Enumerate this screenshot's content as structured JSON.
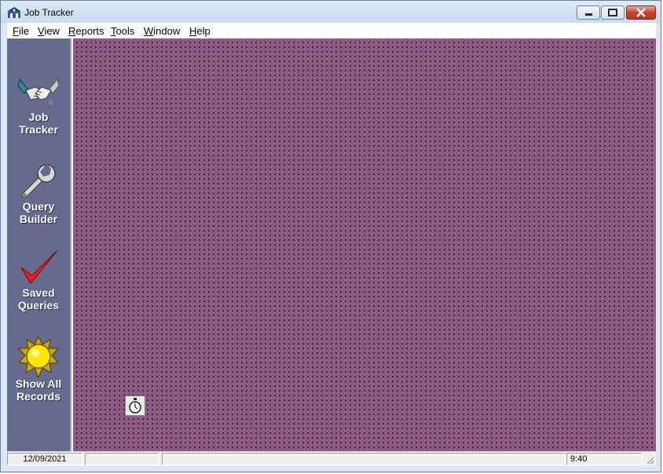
{
  "window": {
    "title": "Job Tracker"
  },
  "menu": [
    {
      "label": "File",
      "accel": "F",
      "rest": "ile"
    },
    {
      "label": "View",
      "accel": "V",
      "rest": "iew"
    },
    {
      "label": "Reports",
      "accel": "R",
      "rest": "eports"
    },
    {
      "label": "Tools",
      "accel": "T",
      "rest": "ools"
    },
    {
      "label": "Window",
      "accel": "W",
      "rest": "indow"
    },
    {
      "label": "Help",
      "accel": "H",
      "rest": "elp"
    }
  ],
  "sidebar": {
    "items": [
      {
        "label": "Job\nTracker",
        "icon": "handshake-icon"
      },
      {
        "label": "Query\nBuilder",
        "icon": "wrench-icon"
      },
      {
        "label": "Saved\nQueries",
        "icon": "checkmark-icon"
      },
      {
        "label": "Show All\nRecords",
        "icon": "sun-icon"
      }
    ]
  },
  "workspace": {
    "minimized_child_icon": "stopwatch-icon",
    "background_color": "#8d5a84"
  },
  "statusbar": {
    "date": "12/09/2021",
    "panel2": "",
    "panel3": "",
    "time": "9:40"
  },
  "colors": {
    "sidebar": "#656b8f",
    "titlebar": "#c9dcef",
    "close_button": "#c6452e"
  }
}
